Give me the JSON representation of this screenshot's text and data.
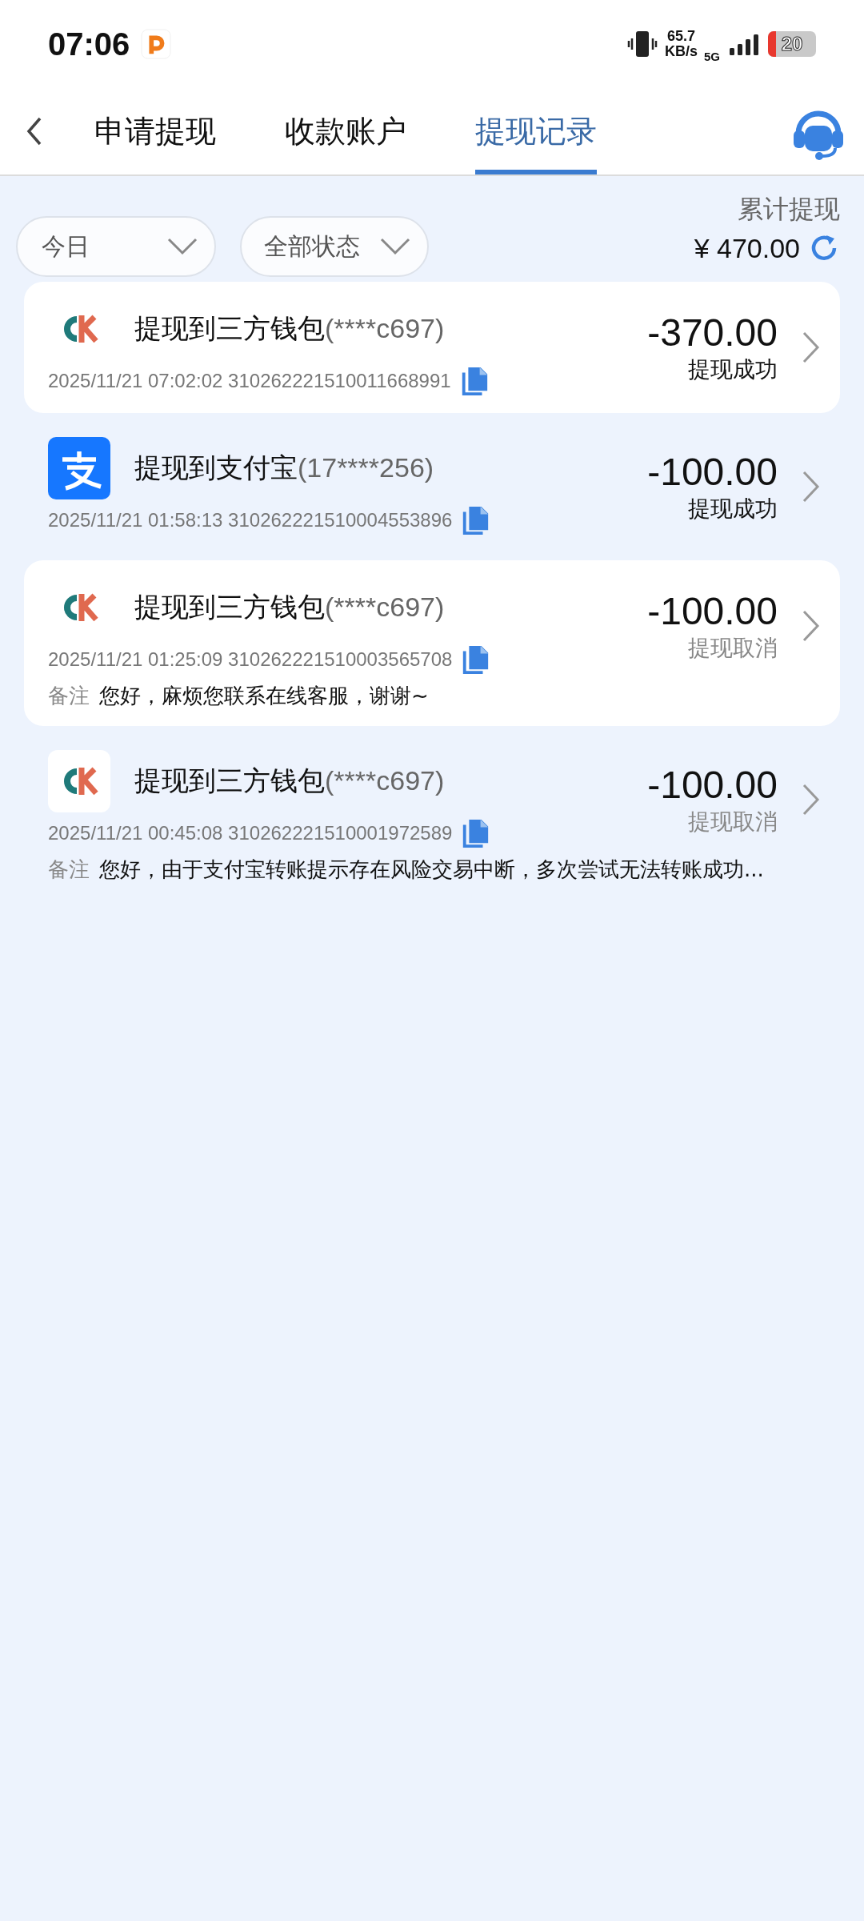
{
  "status_bar": {
    "time": "07:06",
    "net_speed": "65.7",
    "net_unit": "KB/s",
    "network": "5G",
    "battery": "20"
  },
  "tabs": [
    {
      "label": "申请提现",
      "selected": false
    },
    {
      "label": "收款账户",
      "selected": false
    },
    {
      "label": "提现记录",
      "selected": true
    }
  ],
  "filters": [
    {
      "label": "今日"
    },
    {
      "label": "全部状态"
    }
  ],
  "summary": {
    "label": "累计提现",
    "amount": "¥ 470.00"
  },
  "records": [
    {
      "kind": "wallet",
      "highlighted": true,
      "title": "提现到三方钱包",
      "account": "(****c697)",
      "time": "2025/11/21 07:02:02",
      "order_no": "310262221510011668991",
      "amount": "-370.00",
      "status": "提现成功",
      "cancelled": false
    },
    {
      "kind": "alipay",
      "highlighted": false,
      "title": "提现到支付宝",
      "account": "(17****256)",
      "time": "2025/11/21 01:58:13",
      "order_no": "310262221510004553896",
      "amount": "-100.00",
      "status": "提现成功",
      "cancelled": false
    },
    {
      "kind": "wallet",
      "highlighted": true,
      "title": "提现到三方钱包",
      "account": "(****c697)",
      "time": "2025/11/21 01:25:09",
      "order_no": "310262221510003565708",
      "amount": "-100.00",
      "status": "提现取消",
      "cancelled": true,
      "note_label": "备注",
      "note": "您好，麻烦您联系在线客服，谢谢~"
    },
    {
      "kind": "wallet",
      "highlighted": false,
      "title": "提现到三方钱包",
      "account": "(****c697)",
      "time": "2025/11/21 00:45:08",
      "order_no": "310262221510001972589",
      "amount": "-100.00",
      "status": "提现取消",
      "cancelled": true,
      "note_label": "备注",
      "note": "您好，由于支付宝转账提示存在风险交易中断，多次尝试无法转账成功..."
    }
  ]
}
